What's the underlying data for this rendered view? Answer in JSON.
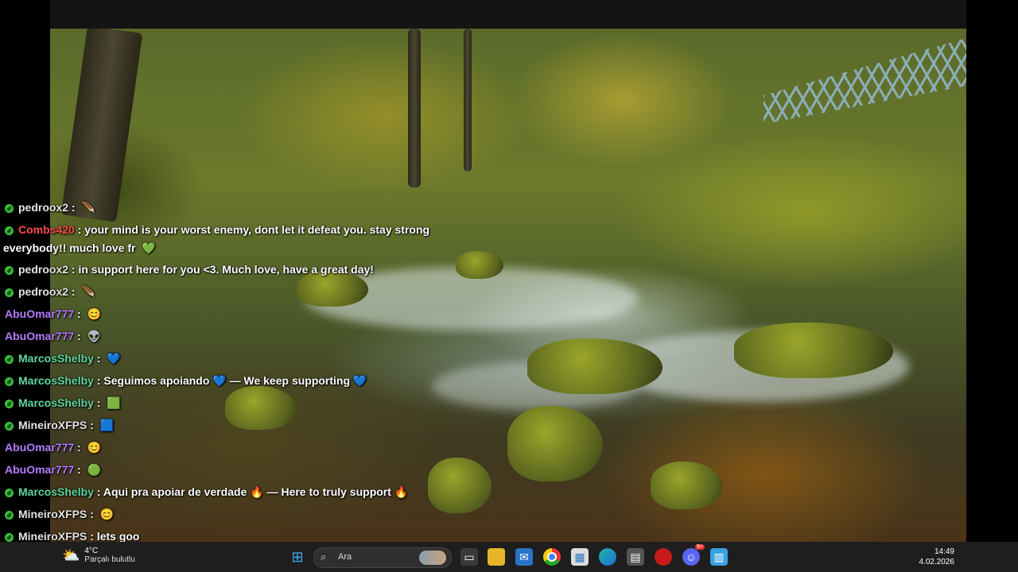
{
  "chat": {
    "messages": [
      {
        "user": "pedroox2",
        "color": "#e3e3e3",
        "text": "",
        "emote": "🪶"
      },
      {
        "user": "Combs420",
        "color": "#ff4a4a",
        "text": "your mind is your worst enemy, dont let it defeat you. stay strong",
        "cont": "everybody!! much love fr",
        "emote": "💚"
      },
      {
        "user": "pedroox2",
        "color": "#e3e3e3",
        "text": "in support here for you <3. Much love, have a great day!"
      },
      {
        "user": "pedroox2",
        "color": "#e3e3e3",
        "text": "",
        "emote": "🪶"
      },
      {
        "user": "AbuOmar777",
        "color": "#b67bff",
        "text": "",
        "emote": "😊"
      },
      {
        "user": "AbuOmar777",
        "color": "#b67bff",
        "text": "",
        "emote": "👽"
      },
      {
        "user": "MarcosShelby",
        "color": "#5fd6a0",
        "text": "",
        "emote": "💙"
      },
      {
        "user": "MarcosShelby",
        "color": "#5fd6a0",
        "text": "Seguimos apoiando 💙 — We keep supporting 💙"
      },
      {
        "user": "MarcosShelby",
        "color": "#5fd6a0",
        "text": "",
        "emote": "🟩"
      },
      {
        "user": "MineiroXFPS",
        "color": "#e3e3e3",
        "text": "",
        "emote": "🟦"
      },
      {
        "user": "AbuOmar777",
        "color": "#b67bff",
        "text": "",
        "emote": "😊"
      },
      {
        "user": "AbuOmar777",
        "color": "#b67bff",
        "text": "",
        "emote": "🟢"
      },
      {
        "user": "MarcosShelby",
        "color": "#5fd6a0",
        "text": "Aqui pra apoiar de verdade 🔥 — Here to truly support 🔥"
      },
      {
        "user": "MineiroXFPS",
        "color": "#e3e3e3",
        "text": "",
        "emote": "😊"
      },
      {
        "user": "MineiroXFPS",
        "color": "#e3e3e3",
        "text": "lets goo"
      }
    ]
  },
  "taskbar": {
    "weather_temp": "4°C",
    "weather_desc": "Parçalı bulutlu",
    "search_placeholder": "Ara",
    "time": "14:49",
    "date": "4.02.2026",
    "icons": [
      "windows-start-icon",
      "task-view-icon",
      "file-explorer-icon",
      "mail-icon",
      "chrome-icon",
      "store-icon",
      "edge-icon",
      "calculator-icon",
      "app-red-icon",
      "discord-icon",
      "notepad-icon"
    ],
    "discord_badge": "9+"
  }
}
